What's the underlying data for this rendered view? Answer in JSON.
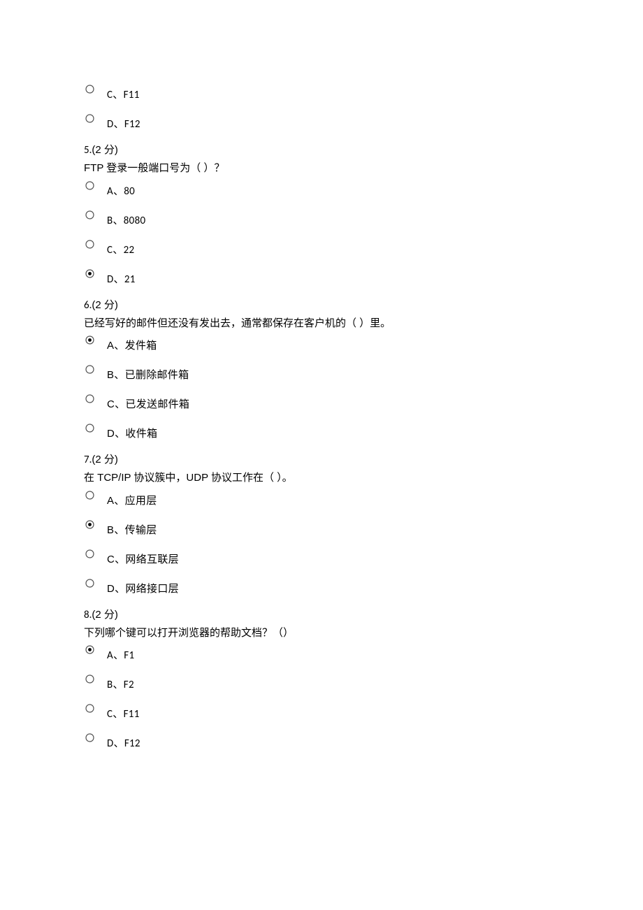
{
  "orphan_options": [
    {
      "label": "C、F11",
      "selected": false
    },
    {
      "label": "D、F12",
      "selected": false
    }
  ],
  "questions": [
    {
      "number": "5.",
      "points": "(2 分)",
      "text": "FTP 登录一般端口号为（  ）？",
      "options": [
        {
          "label": "A、80",
          "selected": false
        },
        {
          "label": "B、8080",
          "selected": false
        },
        {
          "label": "C、22",
          "selected": false
        },
        {
          "label": "D、21",
          "selected": true
        }
      ]
    },
    {
      "number": "6.",
      "points": "(2 分)",
      "text": "已经写好的邮件但还没有发出去，通常都保存在客户机的（  ）里。",
      "options": [
        {
          "label": "A、发件箱",
          "selected": true
        },
        {
          "label": "B、已删除邮件箱",
          "selected": false
        },
        {
          "label": "C、已发送邮件箱",
          "selected": false
        },
        {
          "label": "D、收件箱",
          "selected": false
        }
      ]
    },
    {
      "number": "7.",
      "points": "(2 分)",
      "text": "在 TCP/IP 协议簇中，UDP 协议工作在（  ）。",
      "options": [
        {
          "label": "A、应用层",
          "selected": false
        },
        {
          "label": "B、传输层",
          "selected": true
        },
        {
          "label": "C、网络互联层",
          "selected": false
        },
        {
          "label": "D、网络接口层",
          "selected": false
        }
      ]
    },
    {
      "number": "8.",
      "points": "(2 分)",
      "text": "下列哪个键可以打开浏览器的帮助文档？（）",
      "options": [
        {
          "label": "A、F1",
          "selected": true
        },
        {
          "label": "B、F2",
          "selected": false
        },
        {
          "label": "C、F11",
          "selected": false
        },
        {
          "label": "D、F12",
          "selected": false
        }
      ]
    }
  ]
}
